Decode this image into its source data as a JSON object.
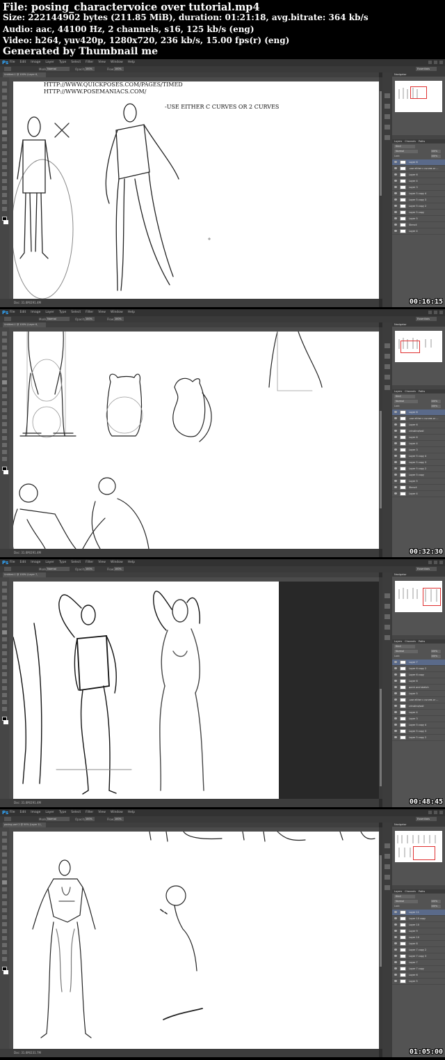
{
  "header": {
    "file": "File: posing_charactervoice over tutorial.mp4",
    "size": "Size: 222144902 bytes (211.85 MiB), duration: 01:21:18, avg.bitrate: 364 kb/s",
    "audio": "Audio: aac, 44100 Hz, 2 channels, s16, 125 kb/s (eng)",
    "video": "Video: h264, yuv420p, 1280x720, 236 kb/s, 15.00 fps(r) (eng)",
    "generated": "Generated by Thumbnail me"
  },
  "app": {
    "logo": "Ps",
    "menu": [
      "File",
      "Edit",
      "Image",
      "Layer",
      "Type",
      "Select",
      "Filter",
      "View",
      "Window",
      "Help"
    ],
    "workspace": "Essentials",
    "options": {
      "mode_label": "Mode:",
      "mode_value": "Normal",
      "opacity_label": "Opacity:",
      "opacity_value": "100%",
      "flow_label": "Flow:",
      "flow_value": "100%"
    },
    "panels": {
      "navigator": "Navigator",
      "layers_tabs": [
        "Layers",
        "Channels",
        "Paths"
      ],
      "kind": "Kind",
      "blend": "Normal",
      "opacity": "100%",
      "fill": "100%",
      "lock": "Lock:"
    }
  },
  "frames": [
    {
      "doc_tab": "Untitled-1 @ 100% (Layer 6, RGB/8) *",
      "status": "Doc: 31.6M/291.4M",
      "timestamp": "00:16:15",
      "canvas_text": {
        "url1": "HTTP://WWW.QUICKPOSES.COM/PAGES/TIMED",
        "url2": "HTTP://WWW.POSEMANIACS.COM/",
        "note": "-USE EITHER C CURVES OR 2 CURVES"
      },
      "layers": [
        "Layer 6",
        "-use either c curves or ...",
        "Layer 6",
        "Layer 4",
        "Layer 3",
        "Layer 5 copy 4",
        "Layer 5 copy 3",
        "Layer 5 copy 2",
        "Layer 5 copy",
        "Layer 5",
        "Stencil",
        "Layer 4"
      ],
      "selected_layer": 0
    },
    {
      "doc_tab": "Untitled-1 @ 100% (Layer 6, RGB/8) *",
      "status": "Doc: 31.6M/291.4M",
      "timestamp": "00:32:30",
      "layers": [
        "Layer 6",
        "-use either c curves or ...",
        "Layer 6",
        "crinoline/sail",
        "Layer 6",
        "Layer 4",
        "Layer 3",
        "Layer 5 copy 4",
        "Layer 5 copy 3",
        "Layer 5 copy 2",
        "Layer 5 copy",
        "Layer 5",
        "Stencil",
        "Layer 4"
      ],
      "selected_layer": 0
    },
    {
      "doc_tab": "Untitled-1 @ 100% (Layer 7, RGB/8) *",
      "status": "Doc: 31.6M/291.4M",
      "timestamp": "00:48:45",
      "layers": [
        "Layer 7",
        "Layer 6 copy 2",
        "Layer 6 copy",
        "Layer 6",
        "quick and sketch",
        "Layer 5",
        "-use either c curves or ...",
        "crinoline/sail",
        "Layer 4",
        "Layer 3",
        "Layer 5 copy 4",
        "Layer 5 copy 3",
        "Layer 5 copy 2"
      ],
      "selected_layer": 0
    },
    {
      "doc_tab": "posing part 2 @ 50% (Layer 11, RGB/8) *",
      "status": "Doc: 31.6M/231.7M",
      "timestamp": "01:05:00",
      "layers": [
        "Layer 11",
        "Layer 10 copy",
        "Layer 10",
        "Layer 9",
        "Layer 10",
        "Layer 8",
        "Layer 7 copy 2",
        "Layer 7 copy 3",
        "Layer 7",
        "Layer 7 copy",
        "Layer 6",
        "Layer 5"
      ],
      "selected_layer": 0
    }
  ]
}
